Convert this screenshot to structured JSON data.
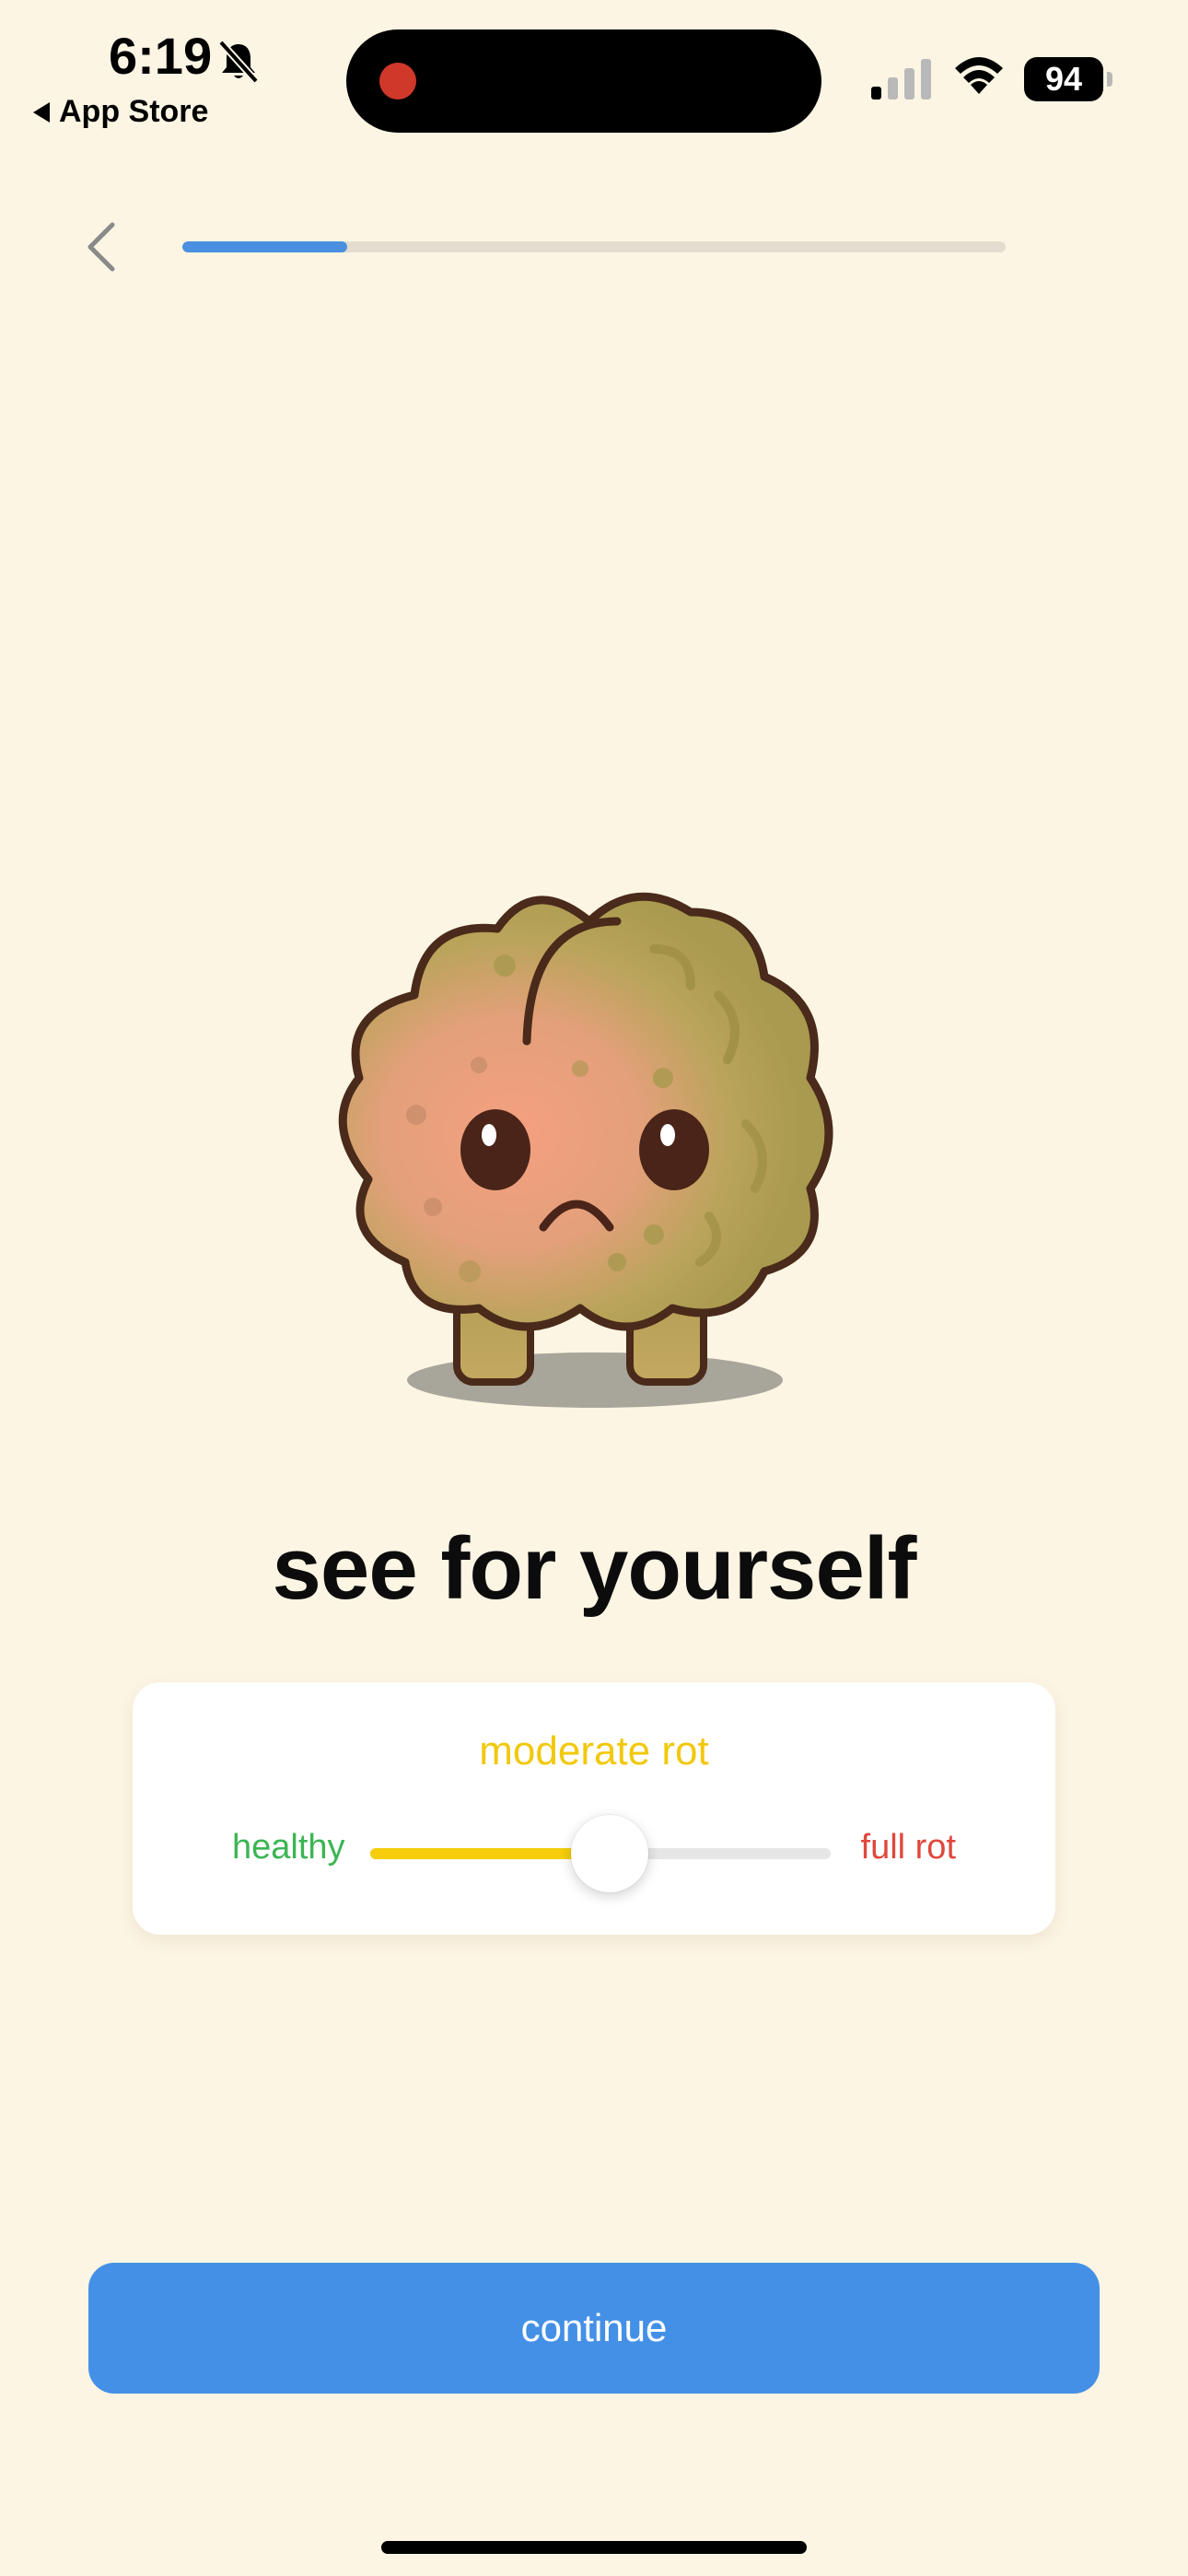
{
  "status_bar": {
    "time": "6:19",
    "back_app": "App Store",
    "battery": "94",
    "icons": [
      "bell-slash-icon",
      "signal-icon",
      "wifi-icon",
      "battery-icon"
    ]
  },
  "header": {
    "back_icon": "chevron-left-icon",
    "progress": 0.2
  },
  "main": {
    "title": "see for yourself"
  },
  "rot_slider": {
    "level_label": "moderate rot",
    "min_label": "healthy",
    "max_label": "full rot",
    "value": 0.52,
    "colors": {
      "level": "#f2c80a",
      "healthy": "#3cb554",
      "full_rot": "#e0473c",
      "fill": "#f5cd0a"
    }
  },
  "footer": {
    "continue_label": "continue",
    "button_color": "#4490e6"
  }
}
